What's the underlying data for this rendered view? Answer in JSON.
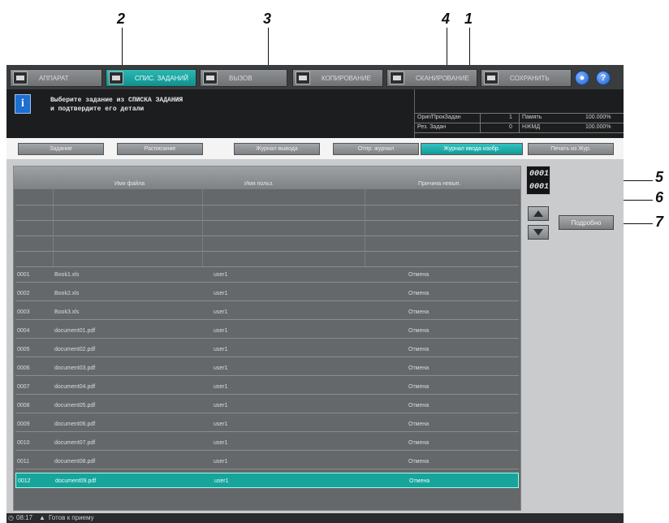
{
  "callouts": [
    "2",
    "3",
    "4",
    "1",
    "5",
    "6",
    "7"
  ],
  "top_tabs": [
    {
      "label": "АППАРАТ",
      "icon": "machine-icon"
    },
    {
      "label": "СПИС. ЗАДАНИЙ",
      "icon": "job-list-icon"
    },
    {
      "label": "ВЫЗОВ",
      "icon": "recall-icon"
    },
    {
      "label": "КОПИРОВАНИЕ",
      "icon": "copy-icon"
    },
    {
      "label": "СКАНИРОВАНИЕ",
      "icon": "scan-icon"
    },
    {
      "label": "СОХРАНИТЬ",
      "icon": "save-icon"
    }
  ],
  "message": {
    "line1": "Выберите задание из СПИСКА ЗАДАНИЯ",
    "line2": "и подтвердите его детали"
  },
  "status": {
    "orig_label": "Ориг/ПрокЗадан",
    "orig_value": "1",
    "memory_label": "Память",
    "memory_value": "100.000%",
    "reserve_label": "Рез. Задан",
    "reserve_value": "0",
    "hdd_label": "НЖМД",
    "hdd_value": "100.000%"
  },
  "sub_tabs": [
    "Задание",
    "Расписание",
    "Журнал вывода",
    "Отпр. журнал",
    "Журнал ввода изобр.",
    "Печать из Жур."
  ],
  "columns": [
    "Имя файла",
    "Имя польз.",
    "Причина невып."
  ],
  "rows": [
    {
      "no": "0001",
      "file": "Book1.xls",
      "user": "user1",
      "status": "Отмена"
    },
    {
      "no": "0002",
      "file": "Book2.xls",
      "user": "user1",
      "status": "Отмена"
    },
    {
      "no": "0003",
      "file": "Book3.xls",
      "user": "user1",
      "status": "Отмена"
    },
    {
      "no": "0004",
      "file": "document01.pdf",
      "user": "user1",
      "status": "Отмена"
    },
    {
      "no": "0005",
      "file": "document02.pdf",
      "user": "user1",
      "status": "Отмена"
    },
    {
      "no": "0006",
      "file": "document03.pdf",
      "user": "user1",
      "status": "Отмена"
    },
    {
      "no": "0007",
      "file": "document04.pdf",
      "user": "user1",
      "status": "Отмена"
    },
    {
      "no": "0008",
      "file": "document05.pdf",
      "user": "user1",
      "status": "Отмена"
    },
    {
      "no": "0009",
      "file": "document06.pdf",
      "user": "user1",
      "status": "Отмена"
    },
    {
      "no": "0010",
      "file": "document07.pdf",
      "user": "user1",
      "status": "Отмена"
    },
    {
      "no": "0011",
      "file": "document08.pdf",
      "user": "user1",
      "status": "Отмена"
    },
    {
      "no": "0012",
      "file": "document09.pdf",
      "user": "user1",
      "status": "Отмена"
    }
  ],
  "counter": {
    "current": "0001",
    "total": "0001"
  },
  "detail_label": "Подробно",
  "bottom": {
    "time": "08:17",
    "status_text": "Готов к приему"
  },
  "colors": {
    "accent": "#17a49b",
    "panel": "#65686b",
    "dark": "#1c1d1e"
  }
}
